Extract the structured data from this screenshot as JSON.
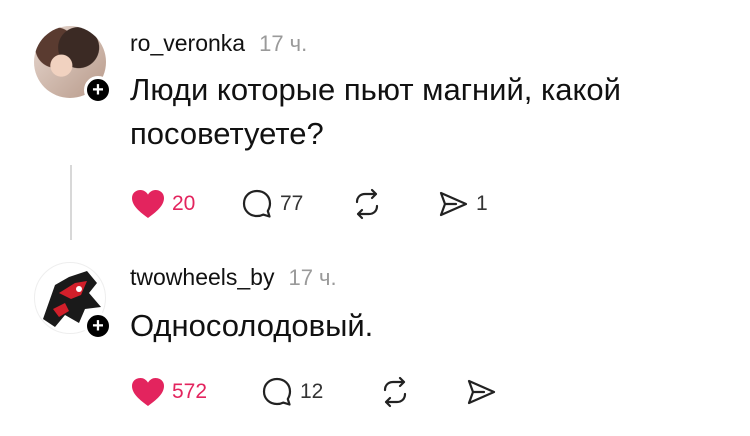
{
  "posts": [
    {
      "username": "ro_veronka",
      "time": "17 ч.",
      "text": "Люди которые пьют магний, какой посоветуете?",
      "likes": "20",
      "comments": "77",
      "reposts": "",
      "shares": "1"
    },
    {
      "username": "twowheels_by",
      "time": "17 ч.",
      "text": "Односолодовый.",
      "likes": "572",
      "comments": "12",
      "reposts": "",
      "shares": ""
    }
  ],
  "colors": {
    "like": "#e3245e",
    "muted": "#9a9a9a"
  },
  "icons": [
    "heart-icon",
    "comment-icon",
    "repost-icon",
    "share-icon",
    "plus-icon"
  ]
}
